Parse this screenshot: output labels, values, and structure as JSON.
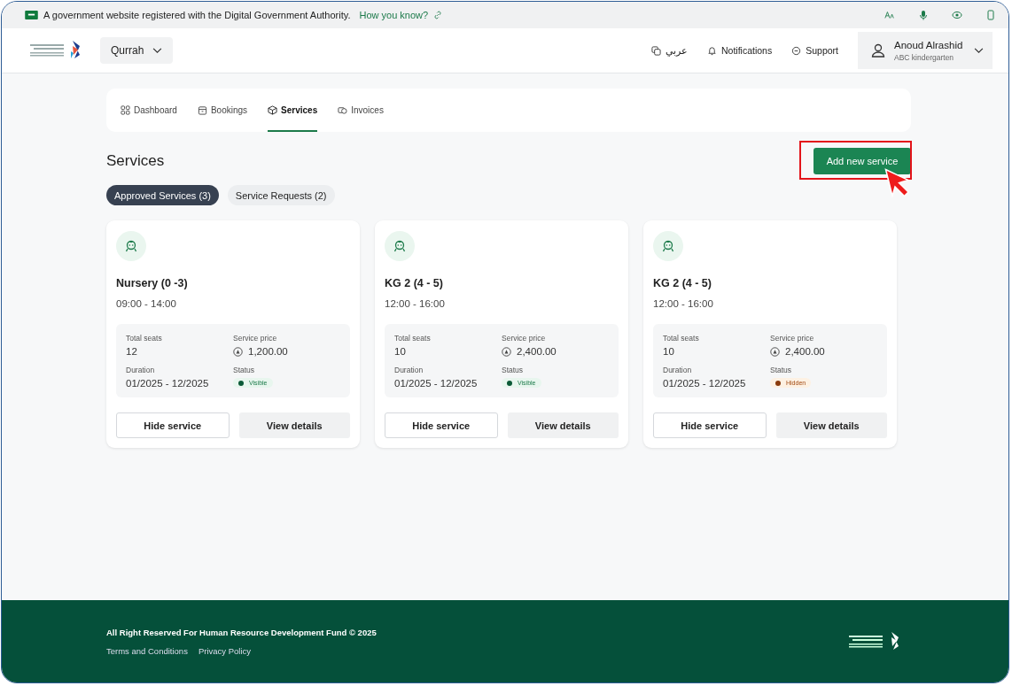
{
  "gov_banner": {
    "text": "A government website registered with the Digital Government Authority.",
    "link": "How you know?"
  },
  "header": {
    "org_selector": "Qurrah",
    "language": "عربي",
    "notifications": "Notifications",
    "support": "Support",
    "user": {
      "name": "Anoud Alrashid",
      "org": "ABC kindergarten"
    }
  },
  "nav_tabs": [
    {
      "label": "Dashboard",
      "kind": "grid",
      "selected": false
    },
    {
      "label": "Bookings",
      "kind": "calendar",
      "selected": false
    },
    {
      "label": "Services",
      "kind": "box",
      "selected": true
    },
    {
      "label": "Invoices",
      "kind": "invoice",
      "selected": false
    }
  ],
  "page_title": "Services",
  "add_button": "Add new service",
  "filters": [
    {
      "label": "Approved Services (3)",
      "selected": true
    },
    {
      "label": "Service Requests (2)",
      "selected": false
    }
  ],
  "cards": [
    {
      "title": "Nursery (0 -3)",
      "hours": "09:00 - 14:00",
      "seats_label": "Total seats",
      "seats": "12",
      "price_label": "Service price",
      "price": "1,200.00",
      "duration_label": "Duration",
      "duration": "01/2025 - 12/2025",
      "status_label": "Status",
      "status": {
        "kind": "visible",
        "label": "Visible"
      },
      "actions": [
        "Hide service",
        "View details"
      ]
    },
    {
      "title": "KG 2 (4 - 5)",
      "hours": "12:00 - 16:00",
      "seats_label": "Total seats",
      "seats": "10",
      "price_label": "Service price",
      "price": "2,400.00",
      "duration_label": "Duration",
      "duration": "01/2025 - 12/2025",
      "status_label": "Status",
      "status": {
        "kind": "visible",
        "label": "Visible"
      },
      "actions": [
        "Hide service",
        "View details"
      ]
    },
    {
      "title": "KG 2 (4 - 5)",
      "hours": "12:00 - 16:00",
      "seats_label": "Total seats",
      "seats": "10",
      "price_label": "Service price",
      "price": "2,400.00",
      "duration_label": "Duration",
      "duration": "01/2025 - 12/2025",
      "status_label": "Status",
      "status": {
        "kind": "hidden",
        "label": "Hidden"
      },
      "actions": [
        "Hide service",
        "View details"
      ]
    }
  ],
  "footer": {
    "copyright": "All Right Reserved For Human Resource Development Fund © 2025",
    "links": [
      "Terms and Conditions",
      "Privacy Policy"
    ]
  }
}
